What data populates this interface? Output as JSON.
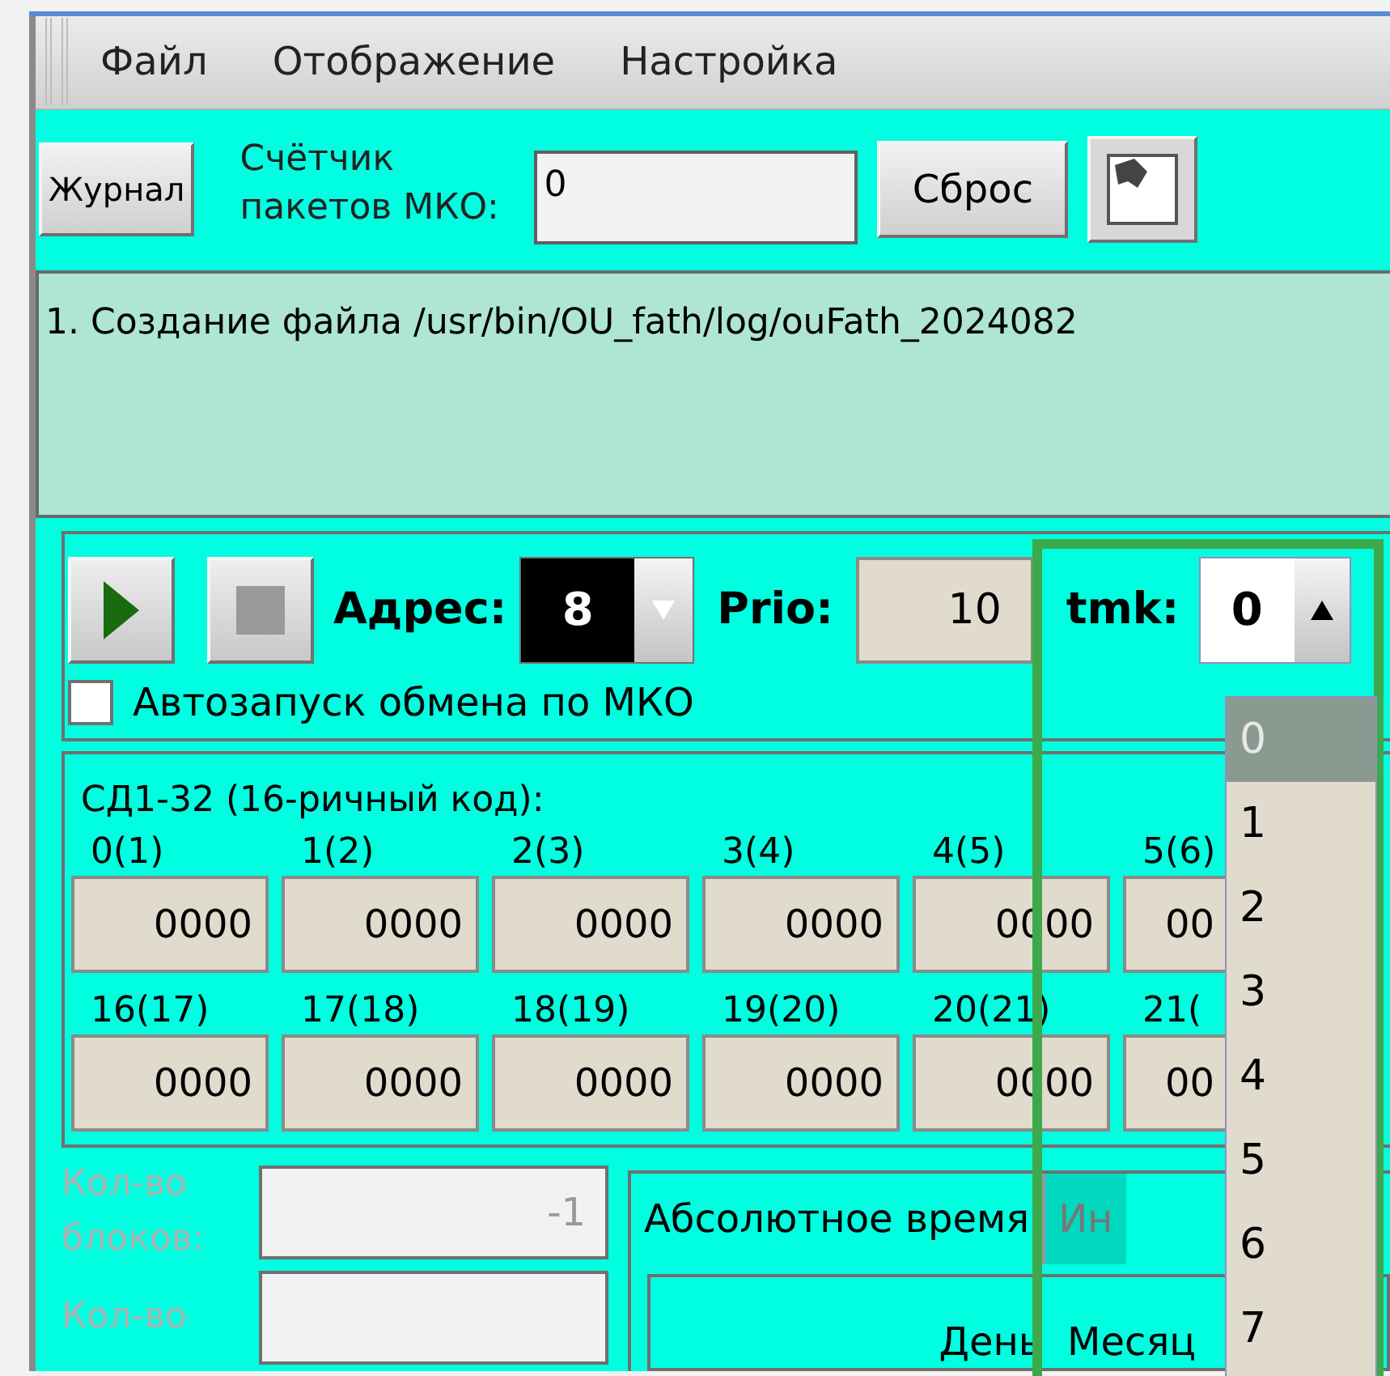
{
  "menu": [
    {
      "label": "Файл"
    },
    {
      "label": "Отображение"
    },
    {
      "label": "Настройка"
    }
  ],
  "toolbar": {
    "journal_button": "Журнал",
    "counter_label": "Счётчик пакетов МКО:",
    "counter_value": "0",
    "reset_button": "Сброс"
  },
  "log": [
    "1. Создание файла /usr/bin/OU_fath/log/ouFath_2024082"
  ],
  "control": {
    "address_label": "Адрес:",
    "address_value": "8",
    "prio_label": "Prio:",
    "prio_value": "10",
    "tmk_label": "tmk:",
    "tmk_value": "0",
    "tmk_options": [
      {
        "label": "0",
        "selected": true
      },
      {
        "label": "1",
        "selected": false
      },
      {
        "label": "2",
        "selected": false
      },
      {
        "label": "3",
        "selected": false
      },
      {
        "label": "4",
        "selected": false
      },
      {
        "label": "5",
        "selected": false
      },
      {
        "label": "6",
        "selected": false
      },
      {
        "label": "7",
        "selected": false
      }
    ],
    "autostart": {
      "label": "Автозапуск обмена по МКО",
      "checked": false
    }
  },
  "hex": {
    "title": "СД1-32 (16-ричный код):",
    "rows": [
      [
        {
          "label": "0(1)",
          "value": "0000"
        },
        {
          "label": "1(2)",
          "value": "0000"
        },
        {
          "label": "2(3)",
          "value": "0000"
        },
        {
          "label": "3(4)",
          "value": "0000"
        },
        {
          "label": "4(5)",
          "value": "0000"
        },
        {
          "label": "5(6)",
          "value": "00"
        }
      ],
      [
        {
          "label": "16(17)",
          "value": "0000"
        },
        {
          "label": "17(18)",
          "value": "0000"
        },
        {
          "label": "18(19)",
          "value": "0000"
        },
        {
          "label": "19(20)",
          "value": "0000"
        },
        {
          "label": "20(21)",
          "value": "0000"
        },
        {
          "label": "21(",
          "value": "00"
        }
      ]
    ]
  },
  "blocks": [
    {
      "label": "Кол-во блоков:",
      "value": "-1",
      "disabled": true
    },
    {
      "label": "Кол-во",
      "disabled": true
    }
  ],
  "tabs": [
    {
      "label": "Абсолютное время",
      "selected": true
    },
    {
      "label": "Ин",
      "selected": false
    }
  ],
  "table": {
    "columns": [
      "День",
      "Месяц"
    ]
  }
}
